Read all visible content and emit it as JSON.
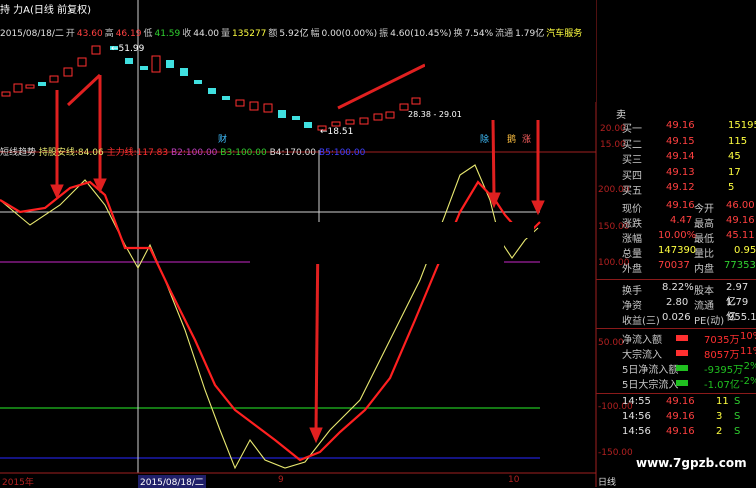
{
  "title": "持 力A(日线 前复权)",
  "info_bar": {
    "date": "2015/08/18/二",
    "open_label": "开",
    "open": "43.60",
    "high_label": "高",
    "high": "46.19",
    "low_label": "低",
    "low": "41.59",
    "close_label": "收",
    "close": "44.00",
    "vol_label": "量",
    "vol": "135277",
    "amount_label": "额",
    "amount": "5.92亿",
    "change_label": "幅",
    "change": "0.00(0.00%)",
    "amp_label": "振",
    "amp": "4.60(10.45%)",
    "turnover_label": "换",
    "turnover": "7.54%",
    "float_label": "流通",
    "float": "1.79亿",
    "industry": "汽车服务"
  },
  "price_labels": {
    "high_mark": "51.99",
    "low_mark": "18.51",
    "right_mark": "28.38 - 29.01"
  },
  "markers": {
    "cai": "财",
    "hui": "除",
    "jing": "鹅",
    "zhang": "涨"
  },
  "indicator_bar": {
    "name": "短线趋势",
    "a": "持股安线:84.06",
    "b": "主力线:117.83",
    "b1": "B2:100.00",
    "b3": "B3:100.00",
    "b4": "B4:170.00",
    "b5": "B5:100.00"
  },
  "axis_right": [
    "200.00",
    "150.00",
    "100.00",
    "50.00",
    "-100.00",
    "-150.00"
  ],
  "axis_right_top": [
    "20.00",
    "15.00"
  ],
  "x_axis": {
    "left": "2015年",
    "mid": "2015/08/18/二",
    "m9": "9",
    "m10": "10",
    "end": "日线"
  },
  "watermark": "www.7gpzb.com",
  "quote": {
    "sells": [
      {
        "label": "买一",
        "price": "49.16",
        "vol": "15195"
      },
      {
        "label": "买二",
        "price": "49.15",
        "vol": "115"
      },
      {
        "label": "买三",
        "price": "49.14",
        "vol": "45"
      },
      {
        "label": "买四",
        "price": "49.13",
        "vol": "17"
      },
      {
        "label": "买五",
        "price": "49.12",
        "vol": "5"
      }
    ],
    "top_label": "卖",
    "now_label": "现价",
    "now": "49.16",
    "open_label": "今开",
    "open": "46.00",
    "chg_label": "涨跌",
    "chg": "4.47",
    "high_label": "最高",
    "high": "49.16",
    "pct_label": "涨幅",
    "pct": "10.00%",
    "low_label": "最低",
    "low": "45.11",
    "vol_label": "总量",
    "vol": "147390",
    "ratio_label": "量比",
    "ratio": "0.95",
    "out_label": "外盘",
    "out": "70037",
    "in_label": "内盘",
    "in": "77353",
    "turn_label": "换手",
    "turn": "8.22%",
    "cap_label": "股本",
    "cap": "2.97亿",
    "nav_label": "净资",
    "nav": "2.80",
    "flow_label": "流通",
    "flow": "1.79亿",
    "eps_label": "收益(三)",
    "eps": "0.026",
    "pe_label": "PE(动)",
    "pe": "955.1",
    "funds": [
      {
        "label": "净流入额",
        "val": "7035万",
        "pct": "10%",
        "color": "#ff3030"
      },
      {
        "label": "大宗流入",
        "val": "8057万",
        "pct": "11%",
        "color": "#ff3030"
      },
      {
        "label": "5日净流入额",
        "val": "-9395万",
        "pct": "-2%",
        "color": "#20c020"
      },
      {
        "label": "5日大宗流入",
        "val": "-1.07亿",
        "pct": "-2%",
        "color": "#20c020"
      }
    ],
    "ticks": [
      {
        "time": "14:55",
        "price": "49.16",
        "vol": "11",
        "flag": "S"
      },
      {
        "time": "14:56",
        "price": "49.16",
        "vol": "3",
        "flag": "S"
      },
      {
        "time": "14:56",
        "price": "49.16",
        "vol": "2",
        "flag": "S"
      }
    ]
  }
}
